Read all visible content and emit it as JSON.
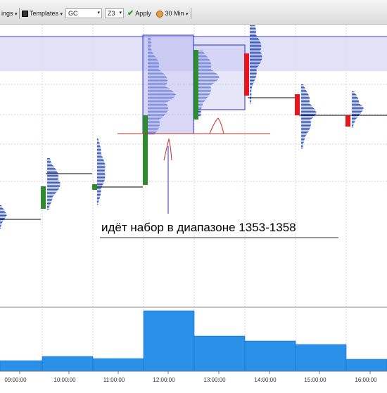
{
  "toolbar": {
    "settings_label": "ings",
    "templates_label": "Templates",
    "instrument_value": "GC",
    "contract_value": "Z3",
    "apply_label": "Apply",
    "timeframe_value": "30 Min"
  },
  "annotation": {
    "text": "идёт набор в  диапазоне 1353-1358"
  },
  "time_axis": {
    "labels": [
      "09:00:00",
      "10:00:00",
      "11:00:00",
      "12:00:00",
      "13:00:00",
      "14:00:00",
      "15:00:00",
      "16:00:00"
    ]
  },
  "colors": {
    "up_bar": "#2e8b2e",
    "down_bar": "#e8141e",
    "volume": "#2a90e8",
    "value_area": "#dcdcf6",
    "profile": "#3b5bd8",
    "box_border": "#2b2bd0",
    "annotation_line": "#d42828"
  }
}
